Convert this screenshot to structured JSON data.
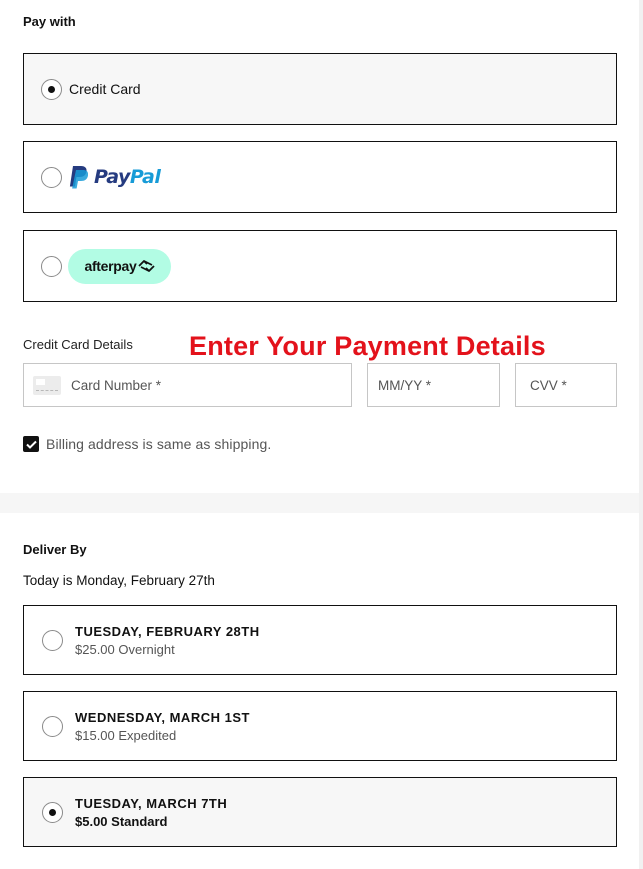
{
  "payment": {
    "title": "Pay with",
    "options": [
      {
        "id": "credit-card",
        "label": "Credit Card",
        "selected": true
      },
      {
        "id": "paypal",
        "label": "PayPal",
        "brand_part1": "Pay",
        "brand_part2": "Pal",
        "selected": false
      },
      {
        "id": "afterpay",
        "label": "afterpay",
        "selected": false
      }
    ]
  },
  "credit_card": {
    "section_label": "Credit Card Details",
    "overlay_heading": "Enter Your Payment Details",
    "card_number": {
      "value": "",
      "placeholder": "Card Number *"
    },
    "expiry": {
      "value": "",
      "placeholder": "MM/YY *"
    },
    "cvv": {
      "value": "",
      "placeholder": "CVV *"
    },
    "billing_same": {
      "label": "Billing address is same as shipping.",
      "checked": true
    }
  },
  "delivery": {
    "title": "Deliver By",
    "today_text": "Today is Monday, February 27th",
    "options": [
      {
        "date": "TUESDAY, FEBRUARY 28TH",
        "price": "$25.00 Overnight",
        "selected": false
      },
      {
        "date": "WEDNESDAY, MARCH 1ST",
        "price": "$15.00 Expedited",
        "selected": false
      },
      {
        "date": "TUESDAY, MARCH 7TH",
        "price": "$5.00 Standard",
        "selected": true
      }
    ]
  },
  "colors": {
    "overlay_red": "#e3121b",
    "paypal_dark": "#253b80",
    "paypal_light": "#179bd7",
    "afterpay_mint": "#b2fce4",
    "selected_bg": "#f7f7f7"
  }
}
